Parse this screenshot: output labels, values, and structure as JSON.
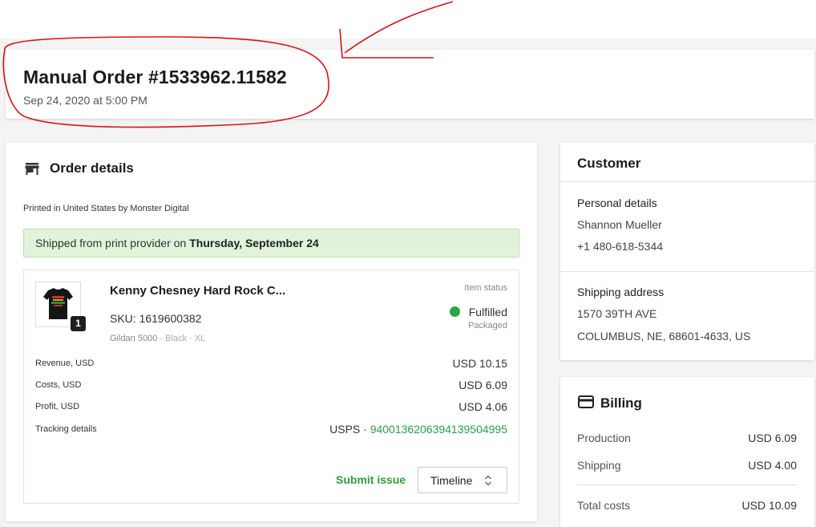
{
  "header": {
    "title": "Manual Order #1533962.11582",
    "date": "Sep 24, 2020 at 5:00 PM"
  },
  "order_details": {
    "title": "Order details",
    "icon": "store-icon",
    "printed_in": "Printed in United States by Monster Digital",
    "shipped_banner": {
      "prefix": "Shipped from print provider on ",
      "date": "Thursday, September 24"
    },
    "item": {
      "name": "Kenny Chesney Hard Rock C...",
      "sku": "SKU: 1619600382",
      "variant_model": "Gildan 5000",
      "variant_sep1": " · ",
      "variant_color": "Black",
      "variant_sep2": " · ",
      "variant_size": "XL",
      "quantity": "1",
      "status_label": "Item status",
      "status": "Fulfilled",
      "status_sub": "Packaged",
      "status_color": "#28a745"
    },
    "financials": [
      {
        "label": "Revenue, USD",
        "value": "USD 10.15"
      },
      {
        "label": "Costs, USD",
        "value": "USD 6.09"
      },
      {
        "label": "Profit, USD",
        "value": "USD 4.06"
      }
    ],
    "tracking": {
      "label": "Tracking details",
      "carrier": "USPS · ",
      "number": "9400136206394139504995"
    },
    "submit_issue": "Submit issue",
    "timeline": "Timeline"
  },
  "customer": {
    "title": "Customer",
    "personal_label": "Personal details",
    "name": "Shannon Mueller",
    "phone": "+1 480-618-5344",
    "shipping_label": "Shipping address",
    "address_line1": "1570 39TH AVE",
    "address_line2": "COLUMBUS, NE, 68601-4633, US"
  },
  "billing": {
    "title": "Billing",
    "icon": "credit-card-icon",
    "rows": [
      {
        "label": "Production",
        "value": "USD 6.09"
      },
      {
        "label": "Shipping",
        "value": "USD 4.00"
      }
    ],
    "total_label": "Total costs",
    "total_value": "USD 10.09"
  },
  "colors": {
    "accent_green": "#2e9d3f",
    "banner_bg": "#e1f4db",
    "annotation_red": "#e01010"
  }
}
